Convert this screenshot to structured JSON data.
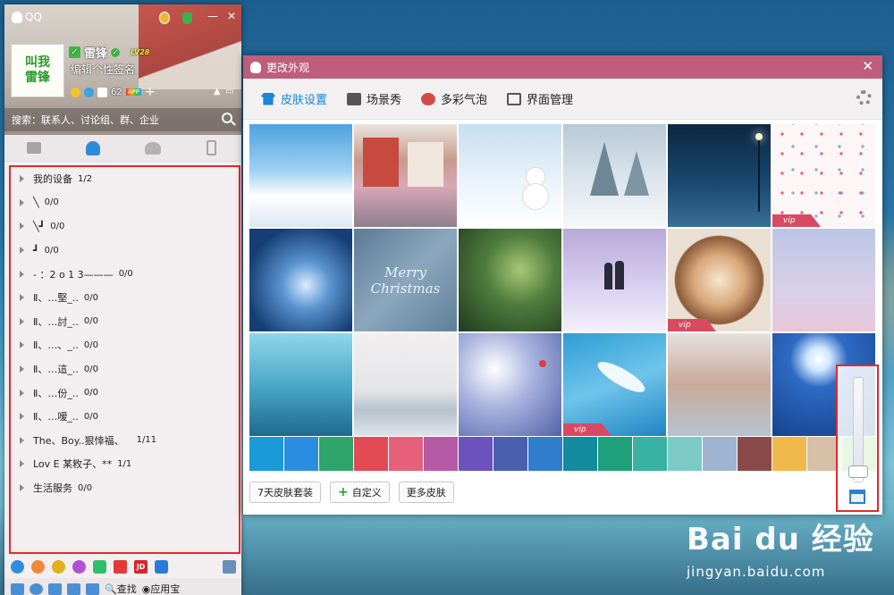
{
  "colors": {
    "dialog_title_bg": "#bf5d7c",
    "active_tab": "#1a86d8",
    "highlight_border": "#e02b2b"
  },
  "qq": {
    "title": "QQ",
    "avatar_text": [
      "叫我",
      "雷锋"
    ],
    "nickname": "雷锋",
    "level": "LV28",
    "signature": "编辑个性签名",
    "mail_count": "62",
    "app_tag": "APP",
    "search_placeholder": "搜索：联系人、讨论组、群、企业",
    "tabs": [
      "messages",
      "contacts",
      "groups",
      "phone"
    ],
    "groups": [
      {
        "name": "我的设备",
        "count": "1/2"
      },
      {
        "name": "╲",
        "count": "0/0"
      },
      {
        "name": "╲┛",
        "count": "0/0"
      },
      {
        "name": "┛",
        "count": "0/0"
      },
      {
        "name": "- ：2 o 1 3———",
        "count": "0/0"
      },
      {
        "name": "Ⅱ、…堅_..",
        "count": "0/0"
      },
      {
        "name": "Ⅱ、…討_..",
        "count": "0/0"
      },
      {
        "name": "Ⅱ、…、_..",
        "count": "0/0"
      },
      {
        "name": "Ⅱ、…這_..",
        "count": "0/0"
      },
      {
        "name": "Ⅱ、…份_..",
        "count": "0/0"
      },
      {
        "name": "Ⅱ、…嗳_..",
        "count": "0/0"
      },
      {
        "name": "The、Boy..狠悻福、",
        "count": "1/11"
      },
      {
        "name": "Lov E 某敉子、**",
        "count": "1/1"
      },
      {
        "name": "生活服务",
        "count": "0/0"
      }
    ],
    "bottom_apps": [
      "qq-browser-icon",
      "avatar-app-icon",
      "game-icon",
      "flower-icon",
      "video-icon",
      "stock-icon",
      "jd-icon",
      "security-icon"
    ],
    "jd_label": "JD",
    "find_label": "查找",
    "app_center_label": "应用宝"
  },
  "dialog": {
    "title": "更改外观",
    "close_symbol": "✕",
    "tabs": [
      {
        "label": "皮肤设置",
        "active": true
      },
      {
        "label": "场景秀",
        "active": false
      },
      {
        "label": "多彩气泡",
        "active": false
      },
      {
        "label": "界面管理",
        "active": false
      }
    ],
    "vip_label": "vip",
    "skins": [
      {
        "name": "sky-clouds",
        "vip": false
      },
      {
        "name": "snowy-street",
        "vip": false
      },
      {
        "name": "snowman",
        "vip": false
      },
      {
        "name": "snowy-trees",
        "vip": false
      },
      {
        "name": "night-lamp",
        "vip": false
      },
      {
        "name": "snowflake-pattern",
        "vip": true
      },
      {
        "name": "ice-snowflake",
        "vip": false
      },
      {
        "name": "merry-christmas",
        "vip": false
      },
      {
        "name": "pine-branch",
        "vip": false
      },
      {
        "name": "couple-in-snow",
        "vip": false
      },
      {
        "name": "coffee-latte",
        "vip": true
      },
      {
        "name": "frost-trees",
        "vip": false
      },
      {
        "name": "blue-branches",
        "vip": false
      },
      {
        "name": "snow-lake",
        "vip": false
      },
      {
        "name": "bird-on-branch",
        "vip": false
      },
      {
        "name": "white-feather",
        "vip": true
      },
      {
        "name": "snow-bridge",
        "vip": false
      },
      {
        "name": "moon-reindeer",
        "vip": false
      }
    ],
    "merry_text": "Merry",
    "christmas_text": "Christmas",
    "swatches": [
      "#1a9ad9",
      "#2b8ddf",
      "#2ea56a",
      "#e24a55",
      "#e6607a",
      "#b65aa5",
      "#6b52bd",
      "#4a5fae",
      "#2f7dcb",
      "#138a9e",
      "#1ea07a",
      "#39b1a3",
      "#7ccac5",
      "#9fb4d0",
      "#8b4a4a",
      "#f0b94c",
      "#d7bfa8",
      "#6cc04a"
    ],
    "buttons": [
      "7天皮肤套装",
      "自定义",
      "更多皮肤"
    ],
    "transparency": 0.1
  },
  "watermark": {
    "brand": "Bai du 经验",
    "url": "jingyan.baidu.com"
  }
}
